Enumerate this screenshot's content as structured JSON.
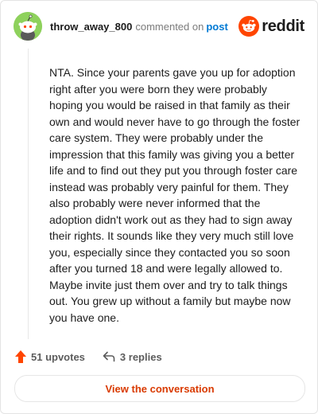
{
  "header": {
    "username": "throw_away_800",
    "action_text": "commented on",
    "post_link": "post",
    "brand": "reddit"
  },
  "comment": {
    "text": "NTA. Since your parents gave you up for adoption right after you were born they were probably hoping you would be raised in that family as their own and would never have to go through the foster care system. They were probably under the impression that this family was giving you a better life and to find out they put you through foster care instead was probably very painful for them. They also probably were never informed that the adoption didn't work out as they had to sign away their rights. It sounds like they very much still love you, especially since they contacted you so soon after you turned 18 and were legally allowed to. Maybe invite just them over and try to talk things out. You grew up without a family but maybe now you have one."
  },
  "actions": {
    "upvotes": "51 upvotes",
    "replies": "3 replies"
  },
  "cta": {
    "label": "View the conversation"
  },
  "colors": {
    "accent": "#ff4500",
    "link": "#0079d3",
    "cta_text": "#d93a00",
    "avatar_bg": "#8ed15c"
  },
  "icons": {
    "avatar": "snoo-avatar-icon",
    "logo": "reddit-logo-icon",
    "upvote": "upvote-arrow-icon",
    "reply": "reply-arrow-icon"
  }
}
